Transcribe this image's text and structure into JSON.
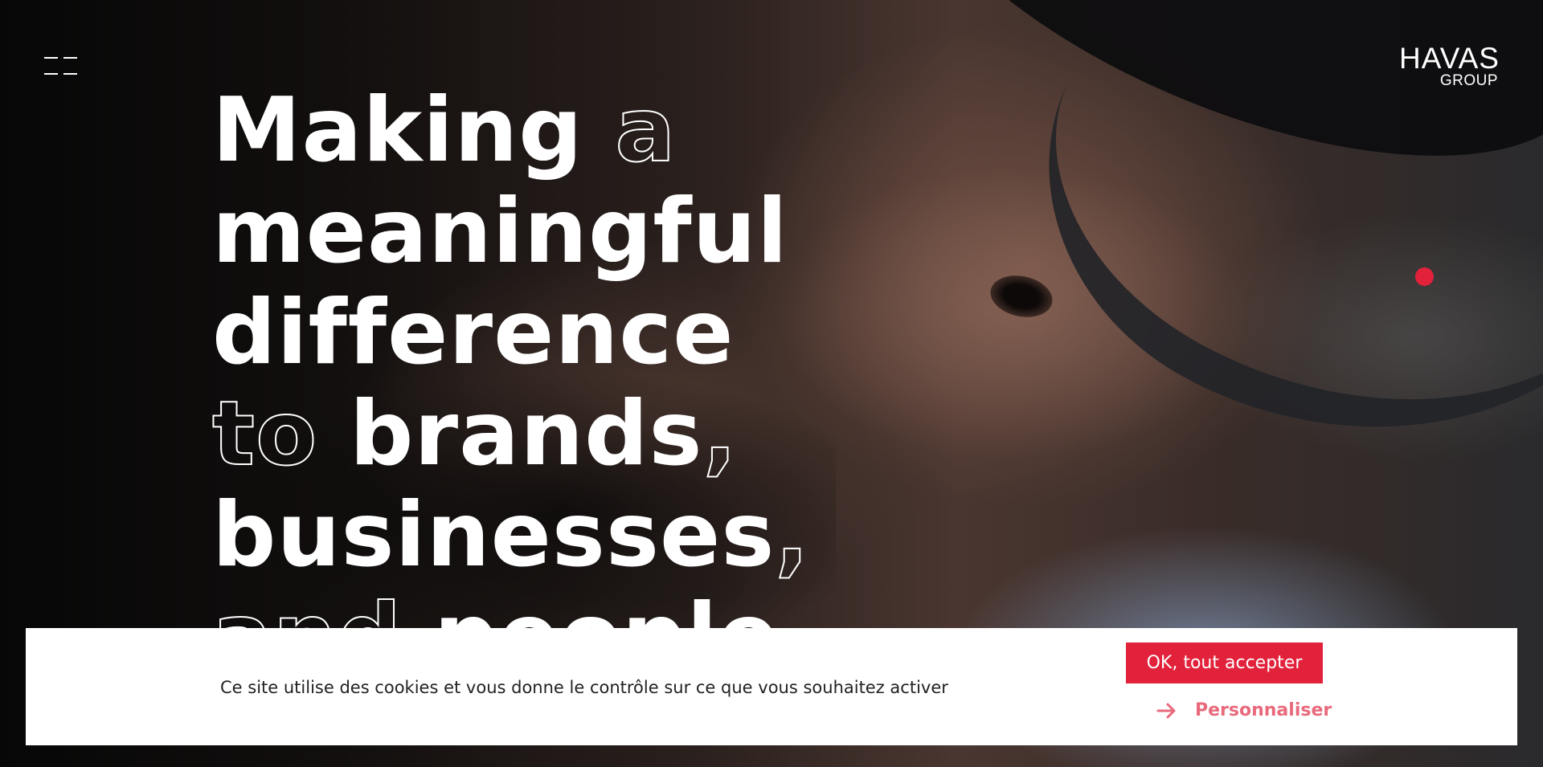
{
  "header": {
    "menu_icon": "menu-icon",
    "logo": {
      "name": "HAVAS",
      "sub": "GROUP"
    }
  },
  "hero": {
    "headline_lines": [
      [
        {
          "text": "Making",
          "style": "solid"
        },
        {
          "text": " a",
          "style": "outline"
        }
      ],
      [
        {
          "text": "meaningful",
          "style": "solid"
        }
      ],
      [
        {
          "text": "difference",
          "style": "solid"
        }
      ],
      [
        {
          "text": "to",
          "style": "outline"
        },
        {
          "text": " brands",
          "style": "solid"
        },
        {
          "text": ",",
          "style": "outline"
        }
      ],
      [
        {
          "text": "businesses",
          "style": "solid"
        },
        {
          "text": ",",
          "style": "outline"
        }
      ],
      [
        {
          "text": "and",
          "style": "outline"
        },
        {
          "text": " people",
          "style": "solid"
        }
      ]
    ],
    "indicator_color": "#e2213b"
  },
  "cookie_banner": {
    "message": "Ce site utilise des cookies et vous donne le contrôle sur ce que vous souhaitez activer",
    "accept_label": "OK, tout accepter",
    "customize_label": "Personnaliser",
    "customize_icon": "arrow-right-icon",
    "accent_color": "#e2213b",
    "link_color": "#e86a7c"
  }
}
